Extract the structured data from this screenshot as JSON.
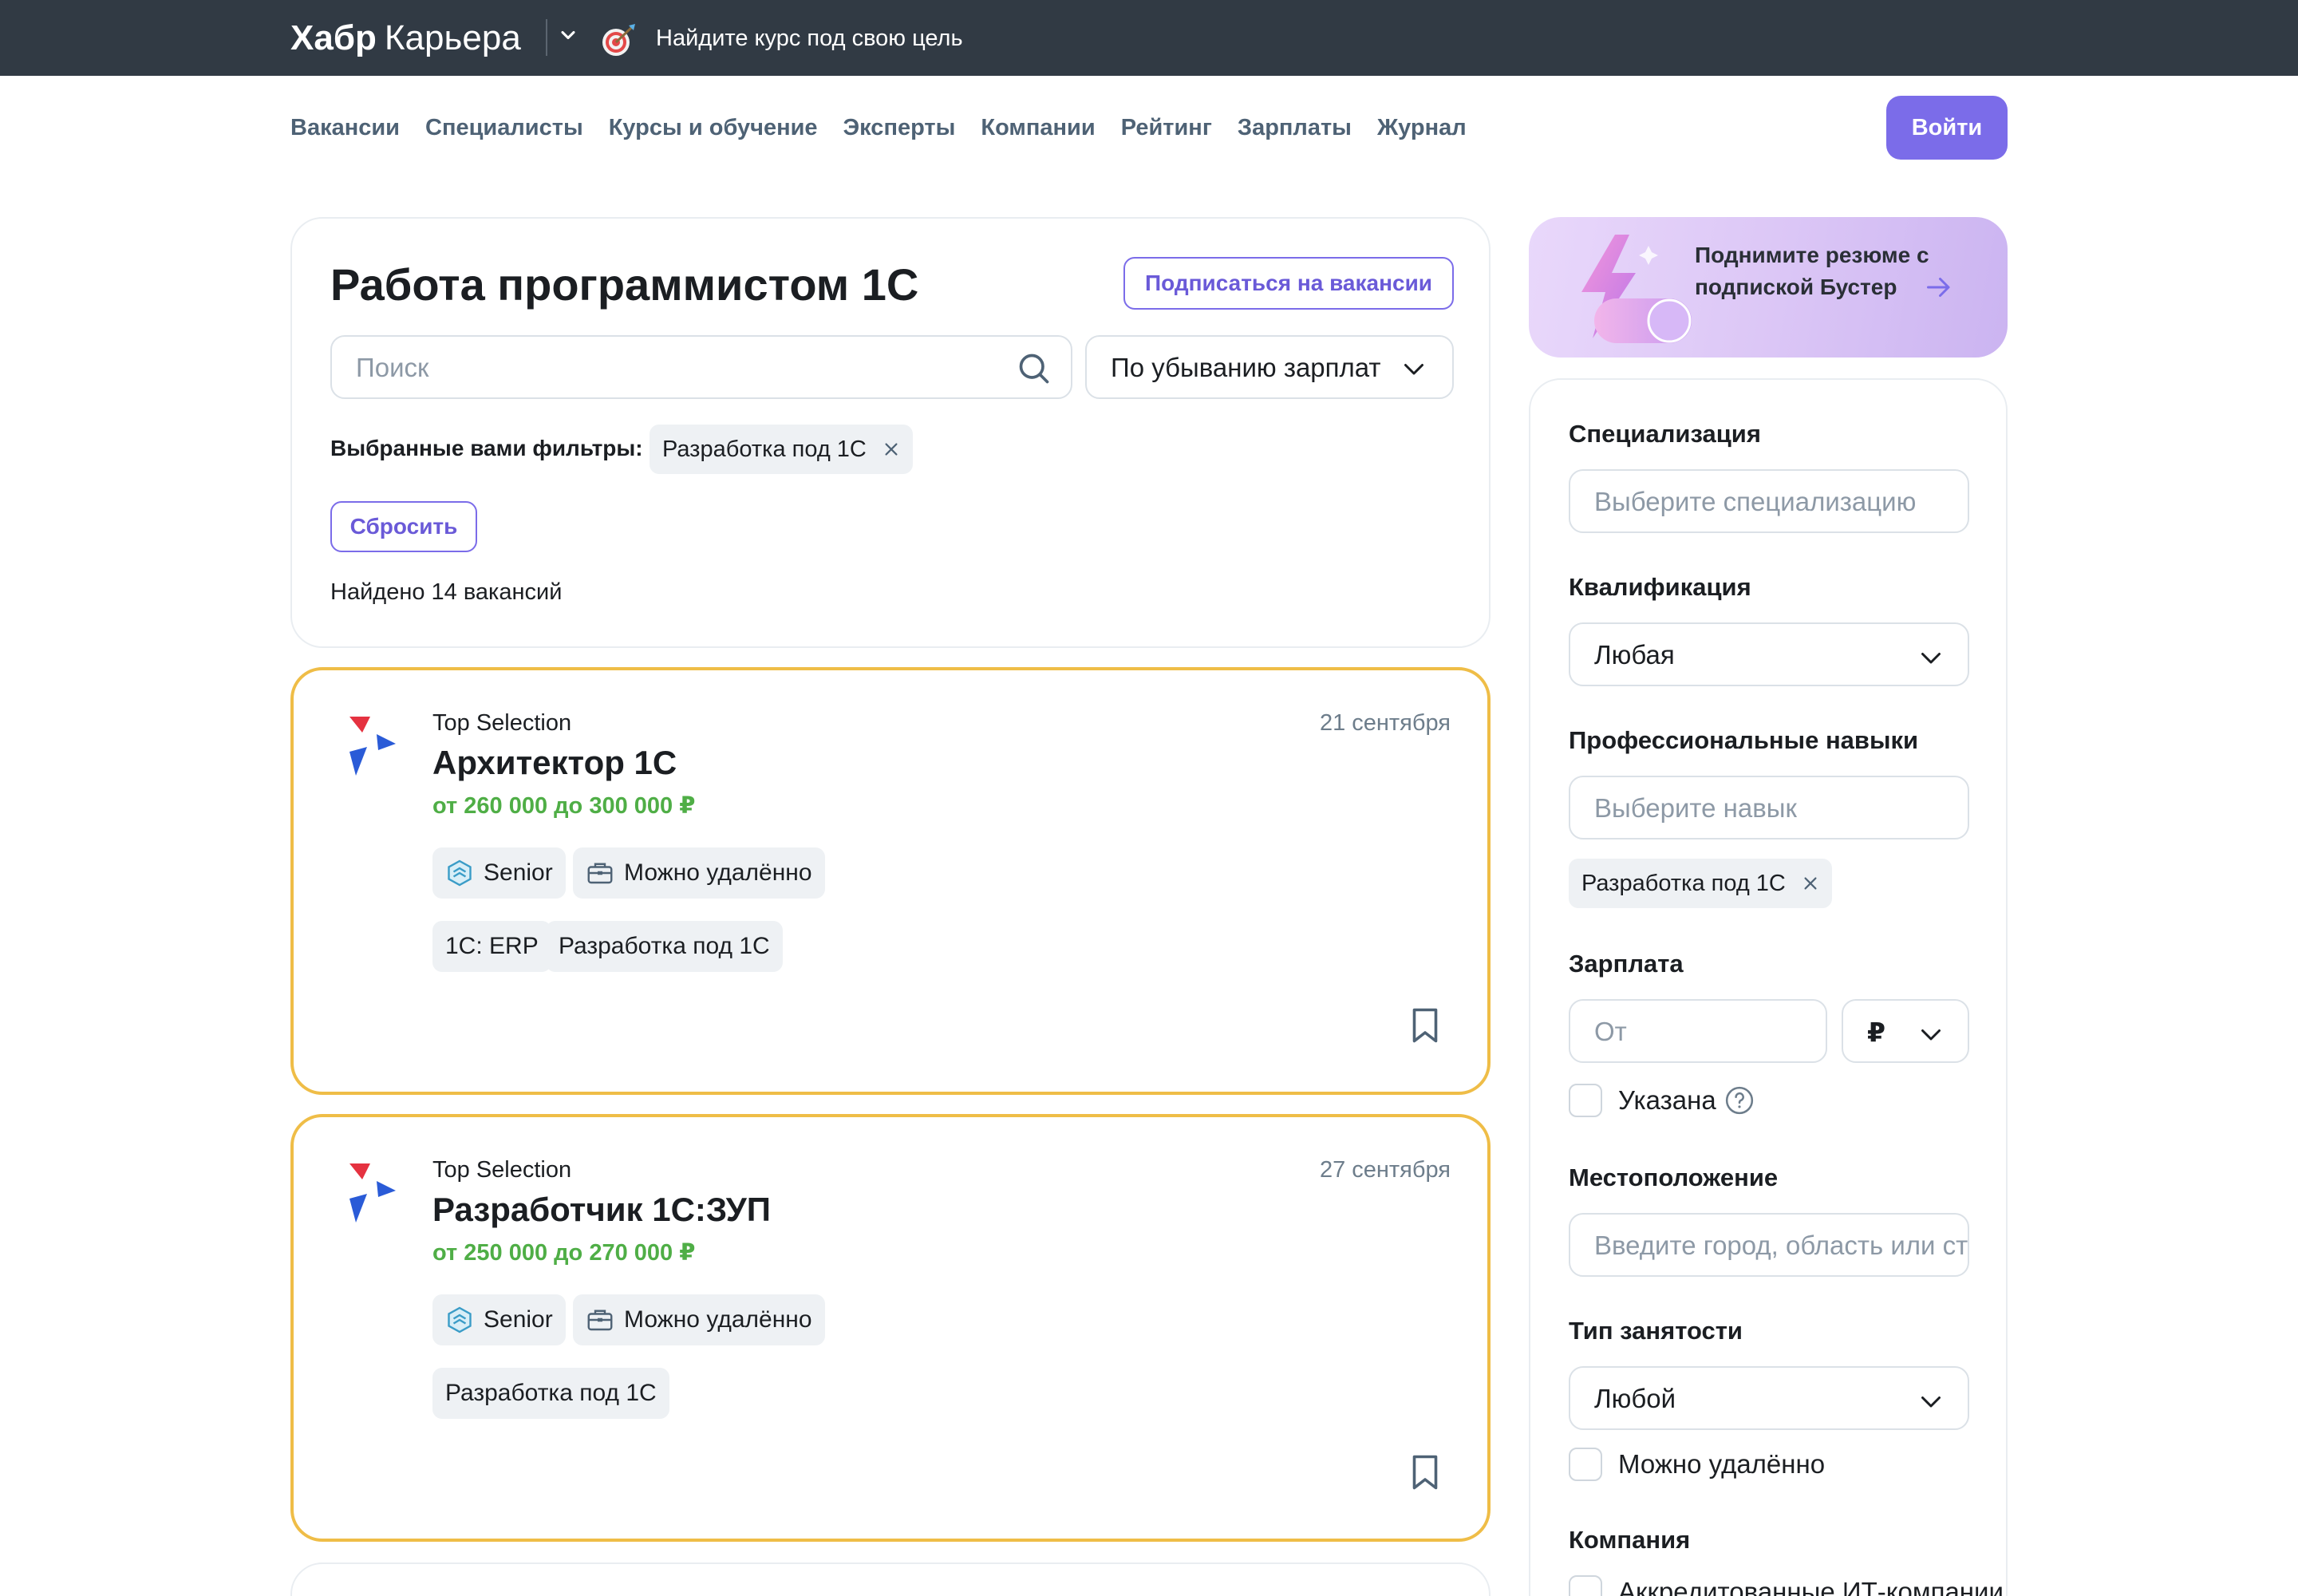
{
  "topbar": {
    "logo_bold": "Хабр",
    "logo_rest": "Карьера",
    "promo_text": "Найдите курс под свою цель"
  },
  "nav": {
    "items": [
      "Вакансии",
      "Специалисты",
      "Курсы и обучение",
      "Эксперты",
      "Компании",
      "Рейтинг",
      "Зарплаты",
      "Журнал"
    ],
    "login": "Войти"
  },
  "header": {
    "title": "Работа программистом 1С",
    "subscribe": "Подписаться на вакансии",
    "search_placeholder": "Поиск",
    "sort_value": "По убыванию зарплаты",
    "filters_label": "Выбранные вами фильтры:",
    "active_filter": "Разработка под 1С",
    "reset": "Сбросить",
    "found": "Найдено 14 вакансий"
  },
  "jobs": [
    {
      "company": "Top Selection",
      "date": "21 сентября",
      "title": "Архитектор 1С",
      "salary": "от 260 000 до 300 000 ₽",
      "level": "Senior",
      "remote": "Можно удалённо",
      "skills": [
        "1С: ERP",
        "Разработка под 1С"
      ]
    },
    {
      "company": "Top Selection",
      "date": "27 сентября",
      "title": "Разработчик 1С:ЗУП",
      "salary": "от 250 000 до 270 000 ₽",
      "level": "Senior",
      "remote": "Можно удалённо",
      "skills": [
        "Разработка под 1С"
      ]
    }
  ],
  "booster": {
    "text": "Поднимите резюме с подпиской Бустер"
  },
  "filters": {
    "specialization_label": "Специализация",
    "specialization_placeholder": "Выберите специализацию",
    "qualification_label": "Квалификация",
    "qualification_value": "Любая",
    "skills_label": "Профессиональные навыки",
    "skills_placeholder": "Выберите навык",
    "skills_chip": "Разработка под 1С",
    "salary_label": "Зарплата",
    "salary_placeholder": "От",
    "currency": "₽",
    "salary_specified": "Указана",
    "location_label": "Местоположение",
    "location_placeholder": "Введите город, область или страну",
    "employment_label": "Тип занятости",
    "employment_value": "Любой",
    "remote_label": "Можно удалённо",
    "company_label": "Компания",
    "accredited_label": "Аккредитованные ИТ-компании"
  },
  "colors": {
    "topbar": "#313a44",
    "accent": "#7b6ce9",
    "salary": "#4fae46",
    "highlight_border": "#efbd47"
  }
}
